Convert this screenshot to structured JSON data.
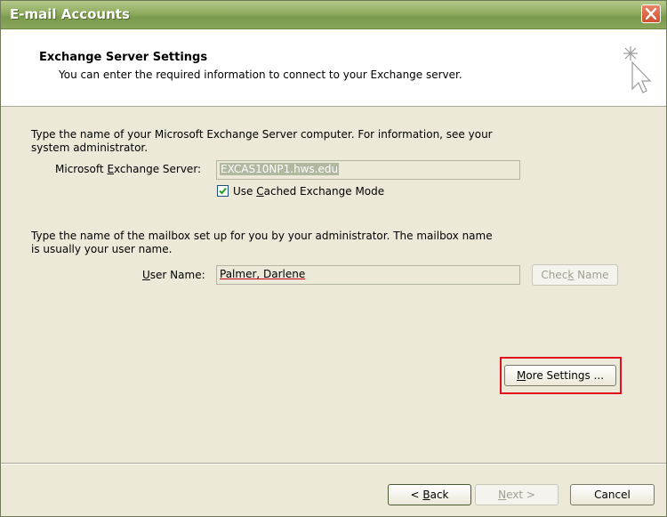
{
  "window": {
    "title": "E-mail Accounts"
  },
  "header": {
    "title": "Exchange Server Settings",
    "subtitle": "You can enter the required information to connect to your Exchange server."
  },
  "server_section": {
    "instruction_line1": "Type the name of your Microsoft Exchange Server computer. For information, see your",
    "instruction_line2": "system administrator.",
    "server_label_pre": "Microsoft ",
    "server_label_key": "E",
    "server_label_post": "xchange Server:",
    "server_value": "EXCAS10NP1.hws.edu",
    "cached_pre": "Use ",
    "cached_key": "C",
    "cached_post": "ached Exchange Mode",
    "cached_checked": true
  },
  "mailbox_section": {
    "instruction_line1": "Type the name of the mailbox set up for you by your administrator. The mailbox name",
    "instruction_line2": "is usually your user name.",
    "user_label_key": "U",
    "user_label_post": "ser Name:",
    "user_value": "Palmer, Darlene",
    "check_name_pre": "Chec",
    "check_name_key": "k",
    "check_name_post": " Name"
  },
  "more_settings": {
    "key": "M",
    "post": "ore Settings ..."
  },
  "footer": {
    "back_pre": "< ",
    "back_key": "B",
    "back_post": "ack",
    "next_pre": "",
    "next_key": "N",
    "next_post": "ext >",
    "cancel_label": "Cancel"
  },
  "colors": {
    "highlight": "#e0101c",
    "title_bar": "#8fab5f",
    "checkmark": "#21a121"
  }
}
